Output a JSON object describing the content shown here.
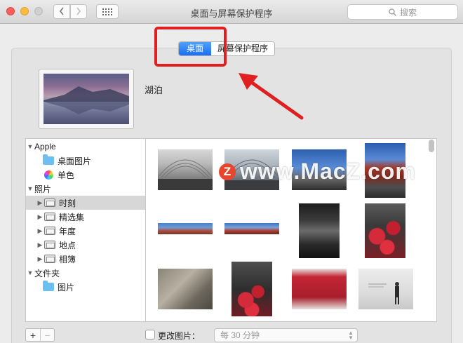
{
  "window": {
    "title": "桌面与屏幕保护程序",
    "search_placeholder": "搜索",
    "back_icon": "chevron-left-icon",
    "forward_icon": "chevron-right-icon",
    "grid_icon": "show-all-grid-icon"
  },
  "tabs": [
    {
      "label": "桌面",
      "selected": true
    },
    {
      "label": "屏幕保护程序",
      "selected": false
    }
  ],
  "current_wallpaper": {
    "name": "湖泊"
  },
  "sidebar": {
    "items": [
      {
        "label": "Apple",
        "level": 0,
        "expanded": true,
        "icon": "none"
      },
      {
        "label": "桌面图片",
        "level": 1,
        "icon": "folder-icon"
      },
      {
        "label": "单色",
        "level": 1,
        "icon": "color-wheel-icon"
      },
      {
        "label": "照片",
        "level": 0,
        "expanded": true,
        "icon": "none"
      },
      {
        "label": "时刻",
        "level": 1,
        "icon": "album-icon",
        "selected": true
      },
      {
        "label": "精选集",
        "level": 1,
        "icon": "album-icon"
      },
      {
        "label": "年度",
        "level": 1,
        "icon": "album-icon"
      },
      {
        "label": "地点",
        "level": 1,
        "icon": "album-icon"
      },
      {
        "label": "相簿",
        "level": 1,
        "icon": "album-icon"
      },
      {
        "label": "文件夹",
        "level": 0,
        "expanded": true,
        "icon": "none"
      },
      {
        "label": "图片",
        "level": 1,
        "icon": "folder-icon"
      }
    ]
  },
  "watermark": {
    "logo": "Z",
    "text": "www.MacZ.com"
  },
  "bottom": {
    "add_label": "+",
    "remove_label": "−",
    "change_picture_label": "更改图片：",
    "change_picture_checked": false,
    "interval_value": "每 30 分钟"
  },
  "colors": {
    "accent": "#1c6ef0",
    "annotation_red": "#e02020",
    "watermark_logo": "#e8452c"
  }
}
